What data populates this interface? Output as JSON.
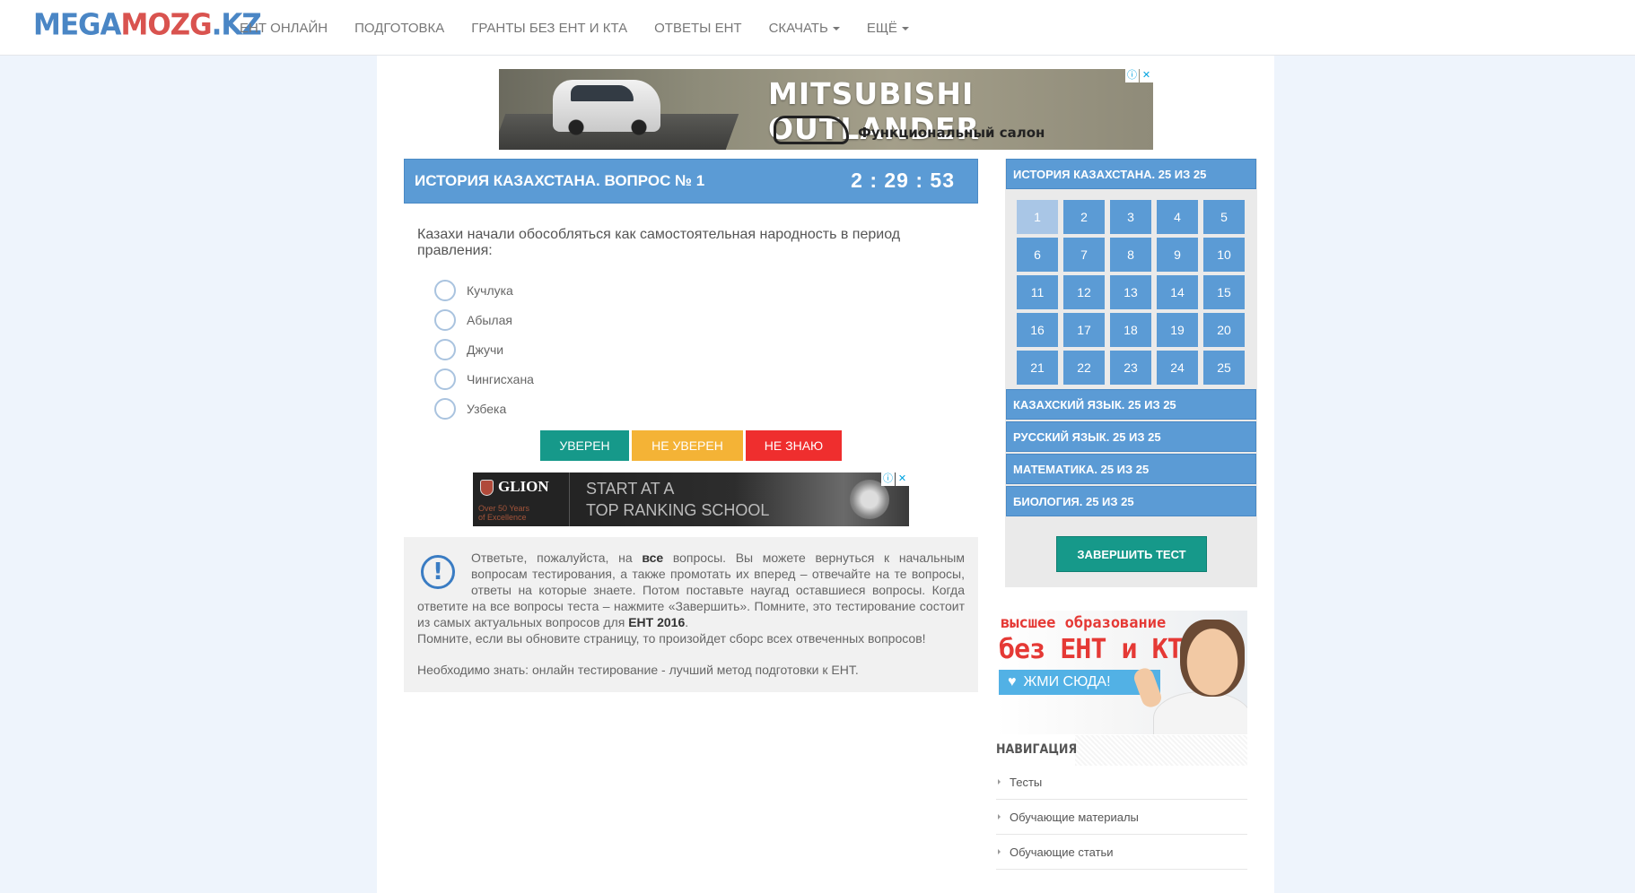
{
  "header": {
    "logo": {
      "part1": "MEGA",
      "part2": "MOZG",
      "part3": ".KZ"
    },
    "nav": [
      {
        "label": "ЕНТ ОНЛАЙН",
        "dropdown": false
      },
      {
        "label": "ПОДГОТОВКА",
        "dropdown": false
      },
      {
        "label": "ГРАНТЫ БЕЗ ЕНТ И КТА",
        "dropdown": false
      },
      {
        "label": "ОТВЕТЫ ЕНТ",
        "dropdown": false
      },
      {
        "label": "СКАЧАТЬ",
        "dropdown": true
      },
      {
        "label": "ЕЩЁ",
        "dropdown": true
      }
    ]
  },
  "ad_top": {
    "headline": "MITSUBISHI OUTLANDER",
    "subline": "Функциональный салон",
    "info_icon": "info-icon",
    "close_icon": "close-icon",
    "info_glyph": "ⓘ",
    "close_glyph": "✕"
  },
  "question": {
    "title": "ИСТОРИЯ КАЗАХСТАНА. ВОПРОС № 1",
    "timer": "2 : 29 : 53",
    "text": "Казахи начали обособляться как самостоятельная  народность  в период правления:",
    "options": [
      "Кучлука",
      "Абылая",
      "Джучи",
      "Чингисхана",
      "Узбека"
    ]
  },
  "buttons": {
    "sure": "УВЕРЕН",
    "unsure": "НЕ УВЕРЕН",
    "dont_know": "НЕ ЗНАЮ"
  },
  "ad_mid": {
    "brand": "GLION",
    "tagline_1": "Over 50 Years",
    "tagline_2": "of Excellence",
    "line1": "START AT A",
    "line2": "TOP RANKING SCHOOL"
  },
  "info": {
    "icon_glyph": "!",
    "part1": "Ответьте, пожалуйста, на ",
    "bold1": "все",
    "part2": " вопросы. Вы можете вернуться к начальным вопросам тестирования, а также промотать их вперед – отвечайте на те вопросы, ответы на которые знаете. Потом поставьте наугад оставшиеся вопросы. Когда ответите на все вопросы теста – нажмите «Завершить». Помните, это тестирование состоит из самых актуальных вопросов для ",
    "bold2": "ЕНТ 2016",
    "part3": ".",
    "line2": "Помните, если вы обновите страницу, то произойдет сборс всех отвеченных вопросов!",
    "note": "Необходимо знать: онлайн тестирование - лучший метод подготовки к ЕНТ."
  },
  "sidebar": {
    "subjects": [
      "ИСТОРИЯ КАЗАХСТАНА. 25 ИЗ 25",
      "КАЗАХСКИЙ ЯЗЫК. 25 ИЗ 25",
      "РУССКИЙ ЯЗЫК. 25 ИЗ 25",
      "МАТЕМАТИКА. 25 ИЗ 25",
      "БИОЛОГИЯ. 25 ИЗ 25"
    ],
    "questions": [
      "1",
      "2",
      "3",
      "4",
      "5",
      "6",
      "7",
      "8",
      "9",
      "10",
      "11",
      "12",
      "13",
      "14",
      "15",
      "16",
      "17",
      "18",
      "19",
      "20",
      "21",
      "22",
      "23",
      "24",
      "25"
    ],
    "active_question": "1",
    "finish": "ЗАВЕРШИТЬ ТЕСТ"
  },
  "promo": {
    "line1": "высшее образование",
    "line2": "без ЕНТ и КТА",
    "button": "ЖМИ СЮДА!",
    "heart_icon": "heart-icon",
    "heart_glyph": "♥"
  },
  "navigation": {
    "title": "НАВИГАЦИЯ",
    "links": [
      "Тесты",
      "Обучающие материалы",
      "Обучающие статьи"
    ]
  },
  "colors": {
    "primary": "#5b9bd5",
    "sure": "#16998a",
    "unsure": "#f4b336",
    "dont_know": "#ef2e2e",
    "logo_red": "#d9534f"
  }
}
